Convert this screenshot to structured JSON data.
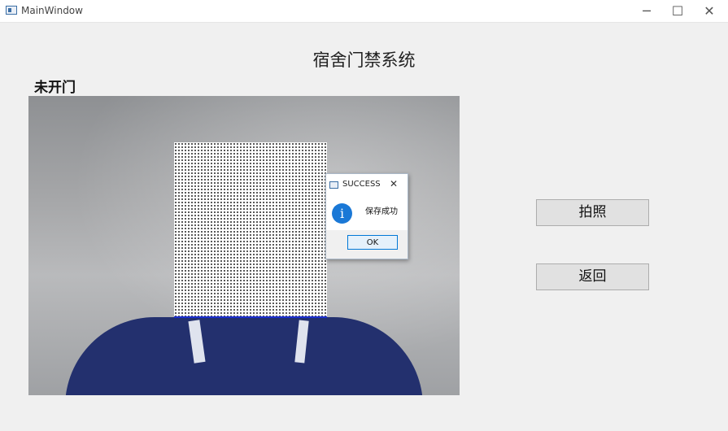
{
  "window": {
    "title": "MainWindow",
    "controls": {
      "minimize": "─",
      "maximize": "☐",
      "close": "✕"
    }
  },
  "main": {
    "heading": "宿舍门禁系统",
    "door_status": "未开门",
    "buttons": {
      "take_photo": "拍照",
      "back": "返回"
    }
  },
  "dialog": {
    "title": "SUCCESS",
    "close": "✕",
    "message": "保存成功",
    "icon_glyph": "i",
    "ok_label": "OK"
  },
  "colors": {
    "face_box_border": "#1b2fd0",
    "info_icon": "#1a78d6",
    "ok_border": "#0078d7"
  }
}
